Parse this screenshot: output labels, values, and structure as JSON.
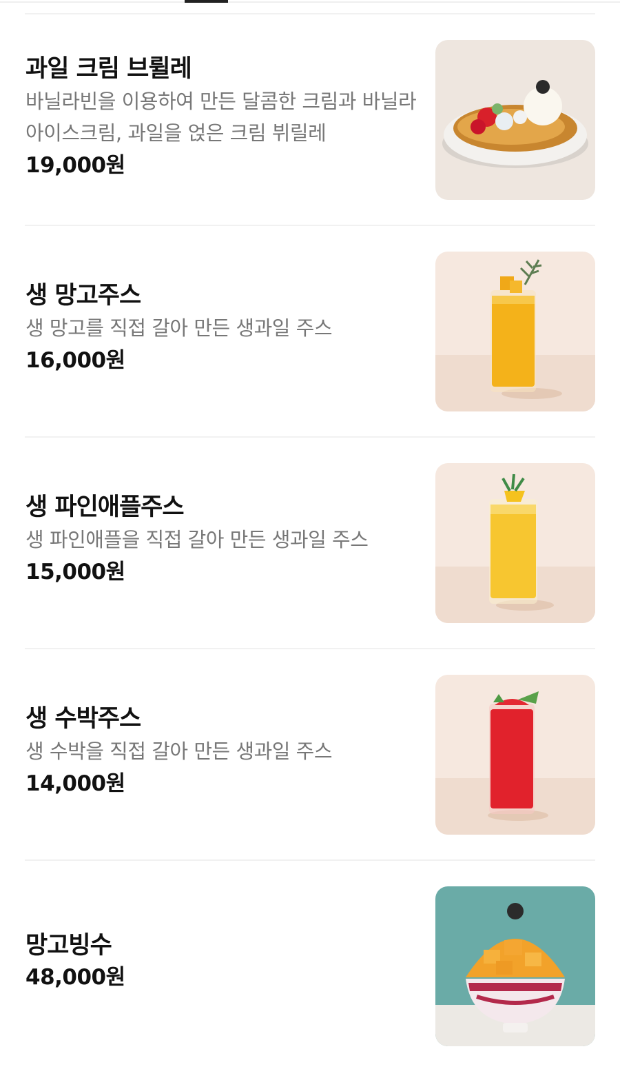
{
  "menu": {
    "items": [
      {
        "name": "과일 크림 브륄레",
        "description": "바닐라빈을 이용하여 만든 달콤한 크림과 바닐라 아이스크림, 과일을 얹은 크림 뷔릴레",
        "price": "19,000원",
        "image": "fruit-cream-brulee-photo"
      },
      {
        "name": "생 망고주스",
        "description": "생 망고를 직접 갈아 만든 생과일 주스",
        "price": "16,000원",
        "image": "mango-juice-photo"
      },
      {
        "name": "생 파인애플주스",
        "description": "생 파인애플을 직접 갈아 만든 생과일 주스",
        "price": "15,000원",
        "image": "pineapple-juice-photo"
      },
      {
        "name": "생 수박주스",
        "description": "생 수박을 직접 갈아 만든 생과일 주스",
        "price": "14,000원",
        "image": "watermelon-juice-photo"
      },
      {
        "name": "망고빙수",
        "price": "48,000원",
        "image": "mango-bingsu-photo"
      }
    ]
  },
  "colors": {
    "price_text": "#111111",
    "description_text": "#777777",
    "divider": "#f1f1f1"
  }
}
